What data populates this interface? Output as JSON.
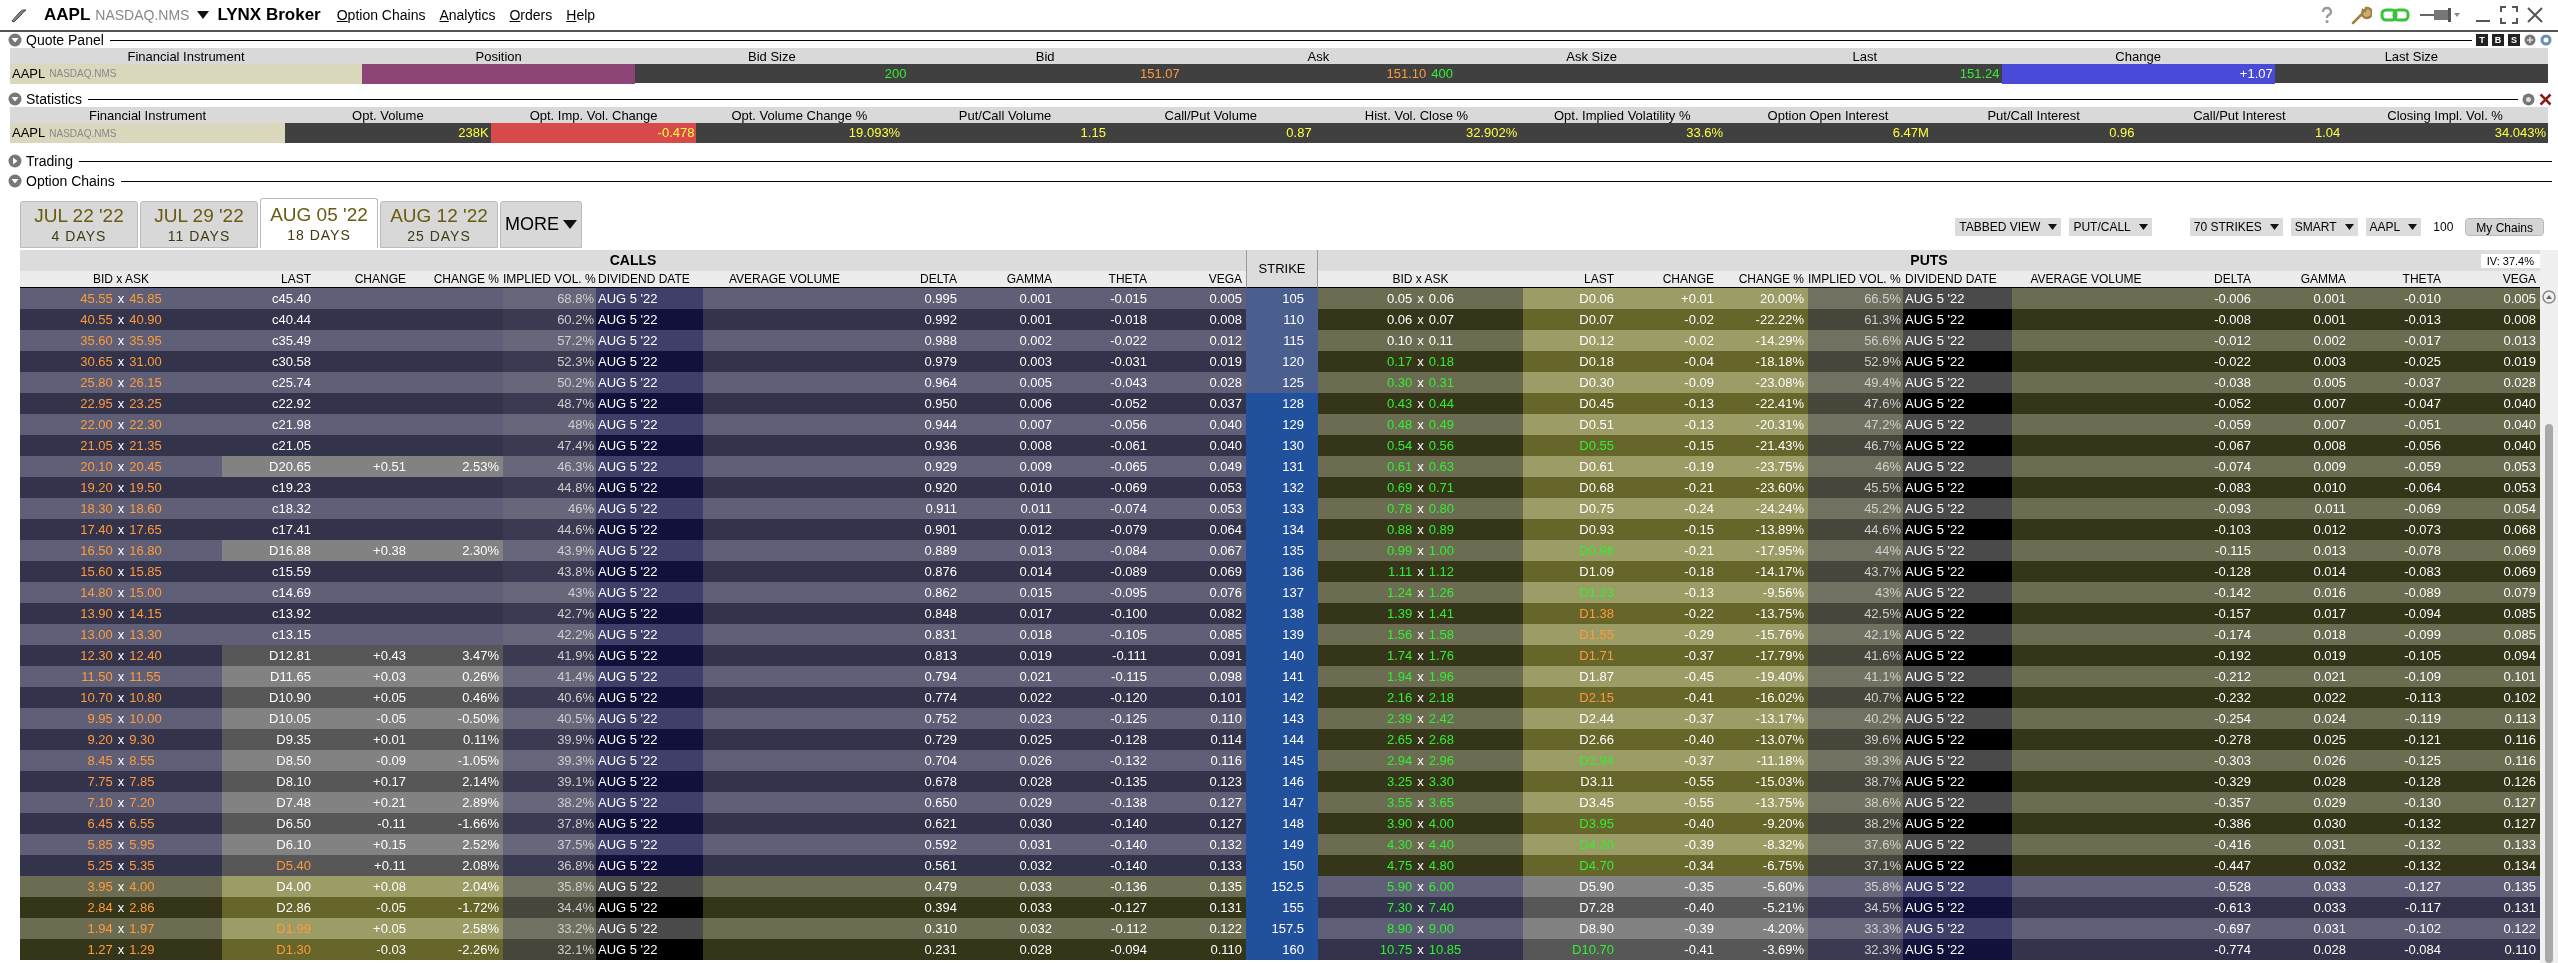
{
  "window": {
    "symbol": "AAPL",
    "exchange": "NASDAQ.NMS",
    "broker": "LYNX Broker"
  },
  "menu": [
    "Option Chains",
    "Analytics",
    "Orders",
    "Help"
  ],
  "quote_panel": {
    "title": "Quote Panel",
    "expanded": true,
    "panel_buttons": [
      "T",
      "B",
      "S"
    ],
    "header_instrument": "Financial Instrument",
    "instrument": {
      "symbol": "AAPL",
      "exchange": "NASDAQ.NMS"
    },
    "cells": [
      {
        "label": "Position",
        "color": "#8b4577"
      },
      {
        "label": "Bid Size",
        "values": [
          {
            "text": "200",
            "up": true,
            "down": false
          }
        ]
      },
      {
        "label": "Bid",
        "values": [
          {
            "text": "151.07",
            "up": false,
            "down": true
          }
        ]
      },
      {
        "label": "Ask",
        "values": [
          {
            "text": "151.10",
            "up": false,
            "down": true
          },
          {
            "text": "400",
            "up": true,
            "down": false
          }
        ]
      },
      {
        "label": "Ask Size"
      },
      {
        "label": "Last",
        "values": [
          {
            "text": "151.24",
            "up": true,
            "down": false
          }
        ]
      },
      {
        "label": "Change",
        "color": "#4a4ad8",
        "values": [
          {
            "text": "+1.07",
            "up": false,
            "down": false
          }
        ]
      },
      {
        "label": "Last Size"
      }
    ]
  },
  "statistics": {
    "title": "Statistics",
    "expanded": true,
    "header_instrument": "Financial Instrument",
    "instrument": {
      "symbol": "AAPL",
      "exchange": "NASDAQ.NMS"
    },
    "cells": [
      {
        "label": "Opt. Volume",
        "value": "238K"
      },
      {
        "label": "Opt. Imp. Vol. Change",
        "value": "-0.478",
        "color": "#d84a4a"
      },
      {
        "label": "Opt. Volume Change %",
        "value": "19.093%"
      },
      {
        "label": "Put/Call Volume",
        "value": "1.15"
      },
      {
        "label": "Call/Put Volume",
        "value": "0.87"
      },
      {
        "label": "Hist. Vol. Close %",
        "value": "32.902%"
      },
      {
        "label": "Opt. Implied Volatility %",
        "value": "33.6%"
      },
      {
        "label": "Option Open Interest",
        "value": "6.47M"
      },
      {
        "label": "Put/Call Interest",
        "value": "0.96"
      },
      {
        "label": "Call/Put Interest",
        "value": "1.04"
      },
      {
        "label": "Closing Impl. Vol. %",
        "value": "34.043%"
      }
    ]
  },
  "trading": {
    "title": "Trading",
    "expanded": false
  },
  "option_chains": {
    "title": "Option Chains",
    "expanded": true,
    "expiries": [
      {
        "date": "JUL 22 '22",
        "days": "4 DAYS",
        "selected": false
      },
      {
        "date": "JUL 29 '22",
        "days": "11 DAYS",
        "selected": false
      },
      {
        "date": "AUG 05 '22",
        "days": "18 DAYS",
        "selected": true
      },
      {
        "date": "AUG 12 '22",
        "days": "25 DAYS",
        "selected": false
      }
    ],
    "more": "MORE",
    "controls": [
      {
        "label": "TABBED VIEW",
        "kind": "dropdown"
      },
      {
        "label": "PUT/CALL",
        "kind": "dropdown"
      },
      {
        "label": "70 STRIKES",
        "kind": "dropdown"
      },
      {
        "label": "SMART",
        "kind": "dropdown"
      },
      {
        "label": "AAPL",
        "kind": "dropdown"
      },
      {
        "label": "100",
        "kind": "text"
      },
      {
        "label": "My Chains",
        "kind": "button"
      }
    ],
    "iv": "IV: 37.4%",
    "calls_title": "CALLS",
    "puts_title": "PUTS",
    "strike_header": "STRIKE",
    "calls_columns": [
      "BID x ASK",
      "LAST",
      "CHANGE",
      "CHANGE %",
      "IMPLIED VOL. %",
      "DIVIDEND DATE",
      "AVERAGE VOLUME",
      "DELTA",
      "GAMMA",
      "THETA",
      "VEGA"
    ],
    "puts_columns": [
      "BID x ASK",
      "LAST",
      "CHANGE",
      "CHANGE %",
      "IMPLIED VOL. %",
      "DIVIDEND DATE",
      "AVERAGE VOLUME",
      "DELTA",
      "GAMMA",
      "THETA",
      "VEGA"
    ],
    "rows": [
      {
        "strike": "105",
        "call": {
          "itm": true,
          "bid_ask": {
            "text": "45.55 x 45.85",
            "up": false,
            "down": true
          },
          "last": {
            "text": "c45.40",
            "up": false,
            "down": false
          },
          "iv": "68.8%",
          "dividend_date": "AUG 5 '22",
          "delta": "0.995",
          "gamma": "0.001",
          "theta": "-0.015",
          "vega": "0.005"
        },
        "put": {
          "itm": false,
          "bid_ask": {
            "text": "0.05 x 0.06",
            "up": false,
            "down": false
          },
          "last": {
            "text": "D0.06",
            "up": false,
            "down": false
          },
          "change": "+0.01",
          "change_pct": "20.00%",
          "iv": "66.5%",
          "dividend_date": "AUG 5 '22",
          "delta": "-0.006",
          "gamma": "0.001",
          "theta": "-0.010",
          "vega": "0.005"
        }
      },
      {
        "strike": "110",
        "call": {
          "itm": true,
          "bid_ask": {
            "text": "40.55 x 40.90",
            "up": false,
            "down": true
          },
          "last": {
            "text": "c40.44",
            "up": false,
            "down": false
          },
          "iv": "60.2%",
          "dividend_date": "AUG 5 '22",
          "delta": "0.992",
          "gamma": "0.001",
          "theta": "-0.018",
          "vega": "0.008"
        },
        "put": {
          "itm": false,
          "bid_ask": {
            "text": "0.06 x 0.07",
            "up": false,
            "down": false
          },
          "last": {
            "text": "D0.07",
            "up": false,
            "down": false
          },
          "change": "-0.02",
          "change_pct": "-22.22%",
          "iv": "61.3%",
          "dividend_date": "AUG 5 '22",
          "delta": "-0.008",
          "gamma": "0.001",
          "theta": "-0.013",
          "vega": "0.008"
        }
      },
      {
        "strike": "115",
        "call": {
          "itm": true,
          "bid_ask": {
            "text": "35.60 x 35.95",
            "up": false,
            "down": true
          },
          "last": {
            "text": "c35.49",
            "up": false,
            "down": false
          },
          "iv": "57.2%",
          "dividend_date": "AUG 5 '22",
          "delta": "0.988",
          "gamma": "0.002",
          "theta": "-0.022",
          "vega": "0.012"
        },
        "put": {
          "itm": false,
          "bid_ask": {
            "text": "0.10 x 0.11",
            "up": false,
            "down": false
          },
          "last": {
            "text": "D0.12",
            "up": false,
            "down": false
          },
          "change": "-0.02",
          "change_pct": "-14.29%",
          "iv": "56.6%",
          "dividend_date": "AUG 5 '22",
          "delta": "-0.012",
          "gamma": "0.002",
          "theta": "-0.017",
          "vega": "0.013"
        }
      },
      {
        "strike": "120",
        "call": {
          "itm": true,
          "bid_ask": {
            "text": "30.65 x 31.00",
            "up": false,
            "down": true
          },
          "last": {
            "text": "c30.58",
            "up": false,
            "down": false
          },
          "iv": "52.3%",
          "dividend_date": "AUG 5 '22",
          "delta": "0.979",
          "gamma": "0.003",
          "theta": "-0.031",
          "vega": "0.019"
        },
        "put": {
          "itm": false,
          "bid_ask": {
            "text": "0.17 x 0.18",
            "up": true,
            "down": false
          },
          "last": {
            "text": "D0.18",
            "up": false,
            "down": false
          },
          "change": "-0.04",
          "change_pct": "-18.18%",
          "iv": "52.9%",
          "dividend_date": "AUG 5 '22",
          "delta": "-0.022",
          "gamma": "0.003",
          "theta": "-0.025",
          "vega": "0.019"
        }
      },
      {
        "strike": "125",
        "call": {
          "itm": true,
          "bid_ask": {
            "text": "25.80 x 26.15",
            "up": false,
            "down": true
          },
          "last": {
            "text": "c25.74",
            "up": false,
            "down": false
          },
          "iv": "50.2%",
          "dividend_date": "AUG 5 '22",
          "delta": "0.964",
          "gamma": "0.005",
          "theta": "-0.043",
          "vega": "0.028"
        },
        "put": {
          "itm": false,
          "bid_ask": {
            "text": "0.30 x 0.31",
            "up": true,
            "down": false
          },
          "last": {
            "text": "D0.30",
            "up": false,
            "down": false
          },
          "change": "-0.09",
          "change_pct": "-23.08%",
          "iv": "49.4%",
          "dividend_date": "AUG 5 '22",
          "delta": "-0.038",
          "gamma": "0.005",
          "theta": "-0.037",
          "vega": "0.028"
        }
      },
      {
        "strike": "128",
        "call": {
          "itm": true,
          "bid_ask": {
            "text": "22.95 x 23.25",
            "up": false,
            "down": true
          },
          "last": {
            "text": "c22.92",
            "up": false,
            "down": false
          },
          "iv": "48.7%",
          "dividend_date": "AUG 5 '22",
          "delta": "0.950",
          "gamma": "0.006",
          "theta": "-0.052",
          "vega": "0.037"
        },
        "put": {
          "itm": false,
          "bid_ask": {
            "text": "0.43 x 0.44",
            "up": true,
            "down": false
          },
          "last": {
            "text": "D0.45",
            "up": false,
            "down": false
          },
          "change": "-0.13",
          "change_pct": "-22.41%",
          "iv": "47.6%",
          "dividend_date": "AUG 5 '22",
          "delta": "-0.052",
          "gamma": "0.007",
          "theta": "-0.047",
          "vega": "0.040"
        }
      },
      {
        "strike": "129",
        "call": {
          "itm": true,
          "bid_ask": {
            "text": "22.00 x 22.30",
            "up": false,
            "down": true
          },
          "last": {
            "text": "c21.98",
            "up": false,
            "down": false
          },
          "iv": "48%",
          "dividend_date": "AUG 5 '22",
          "delta": "0.944",
          "gamma": "0.007",
          "theta": "-0.056",
          "vega": "0.040"
        },
        "put": {
          "itm": false,
          "bid_ask": {
            "text": "0.48 x 0.49",
            "up": true,
            "down": false
          },
          "last": {
            "text": "D0.51",
            "up": false,
            "down": false
          },
          "change": "-0.13",
          "change_pct": "-20.31%",
          "iv": "47.2%",
          "dividend_date": "AUG 5 '22",
          "delta": "-0.059",
          "gamma": "0.007",
          "theta": "-0.051",
          "vega": "0.040"
        }
      },
      {
        "strike": "130",
        "call": {
          "itm": true,
          "bid_ask": {
            "text": "21.05 x 21.35",
            "up": false,
            "down": true
          },
          "last": {
            "text": "c21.05",
            "up": false,
            "down": false
          },
          "iv": "47.4%",
          "dividend_date": "AUG 5 '22",
          "delta": "0.936",
          "gamma": "0.008",
          "theta": "-0.061",
          "vega": "0.040"
        },
        "put": {
          "itm": false,
          "bid_ask": {
            "text": "0.54 x 0.56",
            "up": true,
            "down": false
          },
          "last": {
            "text": "D0.55",
            "up": true,
            "down": false
          },
          "change": "-0.15",
          "change_pct": "-21.43%",
          "iv": "46.7%",
          "dividend_date": "AUG 5 '22",
          "delta": "-0.067",
          "gamma": "0.008",
          "theta": "-0.056",
          "vega": "0.040"
        }
      },
      {
        "strike": "131",
        "call": {
          "itm": true,
          "bid_ask": {
            "text": "20.10 x 20.45",
            "up": false,
            "down": true
          },
          "last": {
            "text": "D20.65",
            "up": false,
            "down": false
          },
          "change": "+0.51",
          "change_pct": "2.53%",
          "iv": "46.3%",
          "dividend_date": "AUG 5 '22",
          "delta": "0.929",
          "gamma": "0.009",
          "theta": "-0.065",
          "vega": "0.049"
        },
        "put": {
          "itm": false,
          "bid_ask": {
            "text": "0.61 x 0.63",
            "up": true,
            "down": false
          },
          "last": {
            "text": "D0.61",
            "up": false,
            "down": false
          },
          "change": "-0.19",
          "change_pct": "-23.75%",
          "iv": "46%",
          "dividend_date": "AUG 5 '22",
          "delta": "-0.074",
          "gamma": "0.009",
          "theta": "-0.059",
          "vega": "0.053"
        }
      },
      {
        "strike": "132",
        "call": {
          "itm": true,
          "bid_ask": {
            "text": "19.20 x 19.50",
            "up": false,
            "down": true
          },
          "last": {
            "text": "c19.23",
            "up": false,
            "down": false
          },
          "iv": "44.8%",
          "dividend_date": "AUG 5 '22",
          "delta": "0.920",
          "gamma": "0.010",
          "theta": "-0.069",
          "vega": "0.053"
        },
        "put": {
          "itm": false,
          "bid_ask": {
            "text": "0.69 x 0.71",
            "up": true,
            "down": false
          },
          "last": {
            "text": "D0.68",
            "up": false,
            "down": false
          },
          "change": "-0.21",
          "change_pct": "-23.60%",
          "iv": "45.5%",
          "dividend_date": "AUG 5 '22",
          "delta": "-0.083",
          "gamma": "0.010",
          "theta": "-0.064",
          "vega": "0.053"
        }
      },
      {
        "strike": "133",
        "call": {
          "itm": true,
          "bid_ask": {
            "text": "18.30 x 18.60",
            "up": false,
            "down": true
          },
          "last": {
            "text": "c18.32",
            "up": false,
            "down": false
          },
          "iv": "46%",
          "dividend_date": "AUG 5 '22",
          "delta": "0.911",
          "gamma": "0.011",
          "theta": "-0.074",
          "vega": "0.053"
        },
        "put": {
          "itm": false,
          "bid_ask": {
            "text": "0.78 x 0.80",
            "up": true,
            "down": false
          },
          "last": {
            "text": "D0.75",
            "up": false,
            "down": false
          },
          "change": "-0.24",
          "change_pct": "-24.24%",
          "iv": "45.2%",
          "dividend_date": "AUG 5 '22",
          "delta": "-0.093",
          "gamma": "0.011",
          "theta": "-0.069",
          "vega": "0.054"
        }
      },
      {
        "strike": "134",
        "call": {
          "itm": true,
          "bid_ask": {
            "text": "17.40 x 17.65",
            "up": false,
            "down": true
          },
          "last": {
            "text": "c17.41",
            "up": false,
            "down": false
          },
          "iv": "44.6%",
          "dividend_date": "AUG 5 '22",
          "delta": "0.901",
          "gamma": "0.012",
          "theta": "-0.079",
          "vega": "0.064"
        },
        "put": {
          "itm": false,
          "bid_ask": {
            "text": "0.88 x 0.89",
            "up": true,
            "down": false
          },
          "last": {
            "text": "D0.93",
            "up": false,
            "down": false
          },
          "change": "-0.15",
          "change_pct": "-13.89%",
          "iv": "44.6%",
          "dividend_date": "AUG 5 '22",
          "delta": "-0.103",
          "gamma": "0.012",
          "theta": "-0.073",
          "vega": "0.068"
        }
      },
      {
        "strike": "135",
        "call": {
          "itm": true,
          "bid_ask": {
            "text": "16.50 x 16.80",
            "up": false,
            "down": true
          },
          "last": {
            "text": "D16.88",
            "up": false,
            "down": false
          },
          "change": "+0.38",
          "change_pct": "2.30%",
          "iv": "43.9%",
          "dividend_date": "AUG 5 '22",
          "delta": "0.889",
          "gamma": "0.013",
          "theta": "-0.084",
          "vega": "0.067"
        },
        "put": {
          "itm": false,
          "bid_ask": {
            "text": "0.99 x 1.00",
            "up": true,
            "down": false
          },
          "last": {
            "text": "D0.96",
            "up": true,
            "down": false
          },
          "change": "-0.21",
          "change_pct": "-17.95%",
          "iv": "44%",
          "dividend_date": "AUG 5 '22",
          "delta": "-0.115",
          "gamma": "0.013",
          "theta": "-0.078",
          "vega": "0.069"
        }
      },
      {
        "strike": "136",
        "call": {
          "itm": true,
          "bid_ask": {
            "text": "15.60 x 15.85",
            "up": false,
            "down": true
          },
          "last": {
            "text": "c15.59",
            "up": false,
            "down": false
          },
          "iv": "43.8%",
          "dividend_date": "AUG 5 '22",
          "delta": "0.876",
          "gamma": "0.014",
          "theta": "-0.089",
          "vega": "0.069"
        },
        "put": {
          "itm": false,
          "bid_ask": {
            "text": "1.11 x 1.12",
            "up": true,
            "down": false
          },
          "last": {
            "text": "D1.09",
            "up": false,
            "down": false
          },
          "change": "-0.18",
          "change_pct": "-14.17%",
          "iv": "43.7%",
          "dividend_date": "AUG 5 '22",
          "delta": "-0.128",
          "gamma": "0.014",
          "theta": "-0.083",
          "vega": "0.069"
        }
      },
      {
        "strike": "137",
        "call": {
          "itm": true,
          "bid_ask": {
            "text": "14.80 x 15.00",
            "up": false,
            "down": true
          },
          "last": {
            "text": "c14.69",
            "up": false,
            "down": false
          },
          "iv": "43%",
          "dividend_date": "AUG 5 '22",
          "delta": "0.862",
          "gamma": "0.015",
          "theta": "-0.095",
          "vega": "0.076"
        },
        "put": {
          "itm": false,
          "bid_ask": {
            "text": "1.24 x 1.26",
            "up": true,
            "down": false
          },
          "last": {
            "text": "D1.23",
            "up": true,
            "down": false
          },
          "change": "-0.13",
          "change_pct": "-9.56%",
          "iv": "43%",
          "dividend_date": "AUG 5 '22",
          "delta": "-0.142",
          "gamma": "0.016",
          "theta": "-0.089",
          "vega": "0.079"
        }
      },
      {
        "strike": "138",
        "call": {
          "itm": true,
          "bid_ask": {
            "text": "13.90 x 14.15",
            "up": false,
            "down": true
          },
          "last": {
            "text": "c13.92",
            "up": false,
            "down": false
          },
          "iv": "42.7%",
          "dividend_date": "AUG 5 '22",
          "delta": "0.848",
          "gamma": "0.017",
          "theta": "-0.100",
          "vega": "0.082"
        },
        "put": {
          "itm": false,
          "bid_ask": {
            "text": "1.39 x 1.41",
            "up": true,
            "down": false
          },
          "last": {
            "text": "D1.38",
            "up": false,
            "down": true
          },
          "change": "-0.22",
          "change_pct": "-13.75%",
          "iv": "42.5%",
          "dividend_date": "AUG 5 '22",
          "delta": "-0.157",
          "gamma": "0.017",
          "theta": "-0.094",
          "vega": "0.085"
        }
      },
      {
        "strike": "139",
        "call": {
          "itm": true,
          "bid_ask": {
            "text": "13.00 x 13.30",
            "up": false,
            "down": true
          },
          "last": {
            "text": "c13.15",
            "up": false,
            "down": false
          },
          "iv": "42.2%",
          "dividend_date": "AUG 5 '22",
          "delta": "0.831",
          "gamma": "0.018",
          "theta": "-0.105",
          "vega": "0.085"
        },
        "put": {
          "itm": false,
          "bid_ask": {
            "text": "1.56 x 1.58",
            "up": true,
            "down": false
          },
          "last": {
            "text": "D1.55",
            "up": false,
            "down": true
          },
          "change": "-0.29",
          "change_pct": "-15.76%",
          "iv": "42.1%",
          "dividend_date": "AUG 5 '22",
          "delta": "-0.174",
          "gamma": "0.018",
          "theta": "-0.099",
          "vega": "0.085"
        }
      },
      {
        "strike": "140",
        "call": {
          "itm": true,
          "bid_ask": {
            "text": "12.30 x 12.40",
            "up": false,
            "down": true
          },
          "last": {
            "text": "D12.81",
            "up": false,
            "down": false
          },
          "change": "+0.43",
          "change_pct": "3.47%",
          "iv": "41.9%",
          "dividend_date": "AUG 5 '22",
          "delta": "0.813",
          "gamma": "0.019",
          "theta": "-0.111",
          "vega": "0.091"
        },
        "put": {
          "itm": false,
          "bid_ask": {
            "text": "1.74 x 1.76",
            "up": true,
            "down": false
          },
          "last": {
            "text": "D1.71",
            "up": false,
            "down": true
          },
          "change": "-0.37",
          "change_pct": "-17.79%",
          "iv": "41.6%",
          "dividend_date": "AUG 5 '22",
          "delta": "-0.192",
          "gamma": "0.019",
          "theta": "-0.105",
          "vega": "0.094"
        }
      },
      {
        "strike": "141",
        "call": {
          "itm": true,
          "bid_ask": {
            "text": "11.50 x 11.55",
            "up": false,
            "down": true
          },
          "last": {
            "text": "D11.65",
            "up": false,
            "down": false
          },
          "change": "+0.03",
          "change_pct": "0.26%",
          "iv": "41.4%",
          "dividend_date": "AUG 5 '22",
          "delta": "0.794",
          "gamma": "0.021",
          "theta": "-0.115",
          "vega": "0.098"
        },
        "put": {
          "itm": false,
          "bid_ask": {
            "text": "1.94 x 1.96",
            "up": true,
            "down": false
          },
          "last": {
            "text": "D1.87",
            "up": false,
            "down": false
          },
          "change": "-0.45",
          "change_pct": "-19.40%",
          "iv": "41.1%",
          "dividend_date": "AUG 5 '22",
          "delta": "-0.212",
          "gamma": "0.021",
          "theta": "-0.109",
          "vega": "0.101"
        }
      },
      {
        "strike": "142",
        "call": {
          "itm": true,
          "bid_ask": {
            "text": "10.70 x 10.80",
            "up": false,
            "down": true
          },
          "last": {
            "text": "D10.90",
            "up": false,
            "down": false
          },
          "change": "+0.05",
          "change_pct": "0.46%",
          "iv": "40.6%",
          "dividend_date": "AUG 5 '22",
          "delta": "0.774",
          "gamma": "0.022",
          "theta": "-0.120",
          "vega": "0.101"
        },
        "put": {
          "itm": false,
          "bid_ask": {
            "text": "2.16 x 2.18",
            "up": true,
            "down": false
          },
          "last": {
            "text": "D2.15",
            "up": false,
            "down": true
          },
          "change": "-0.41",
          "change_pct": "-16.02%",
          "iv": "40.7%",
          "dividend_date": "AUG 5 '22",
          "delta": "-0.232",
          "gamma": "0.022",
          "theta": "-0.113",
          "vega": "0.102"
        }
      },
      {
        "strike": "143",
        "call": {
          "itm": true,
          "bid_ask": {
            "text": "9.95 x 10.00",
            "up": false,
            "down": true
          },
          "last": {
            "text": "D10.05",
            "up": false,
            "down": false
          },
          "change": "-0.05",
          "change_pct": "-0.50%",
          "iv": "40.5%",
          "dividend_date": "AUG 5 '22",
          "delta": "0.752",
          "gamma": "0.023",
          "theta": "-0.125",
          "vega": "0.110"
        },
        "put": {
          "itm": false,
          "bid_ask": {
            "text": "2.39 x 2.42",
            "up": true,
            "down": false
          },
          "last": {
            "text": "D2.44",
            "up": false,
            "down": false
          },
          "change": "-0.37",
          "change_pct": "-13.17%",
          "iv": "40.2%",
          "dividend_date": "AUG 5 '22",
          "delta": "-0.254",
          "gamma": "0.024",
          "theta": "-0.119",
          "vega": "0.113"
        }
      },
      {
        "strike": "144",
        "call": {
          "itm": true,
          "bid_ask": {
            "text": "9.20 x 9.30",
            "up": false,
            "down": true
          },
          "last": {
            "text": "D9.35",
            "up": false,
            "down": false
          },
          "change": "+0.01",
          "change_pct": "0.11%",
          "iv": "39.9%",
          "dividend_date": "AUG 5 '22",
          "delta": "0.729",
          "gamma": "0.025",
          "theta": "-0.128",
          "vega": "0.114"
        },
        "put": {
          "itm": false,
          "bid_ask": {
            "text": "2.65 x 2.68",
            "up": true,
            "down": false
          },
          "last": {
            "text": "D2.66",
            "up": false,
            "down": false
          },
          "change": "-0.40",
          "change_pct": "-13.07%",
          "iv": "39.6%",
          "dividend_date": "AUG 5 '22",
          "delta": "-0.278",
          "gamma": "0.025",
          "theta": "-0.121",
          "vega": "0.116"
        }
      },
      {
        "strike": "145",
        "call": {
          "itm": true,
          "bid_ask": {
            "text": "8.45 x 8.55",
            "up": false,
            "down": true
          },
          "last": {
            "text": "D8.50",
            "up": false,
            "down": false
          },
          "change": "-0.09",
          "change_pct": "-1.05%",
          "iv": "39.3%",
          "dividend_date": "AUG 5 '22",
          "delta": "0.704",
          "gamma": "0.026",
          "theta": "-0.132",
          "vega": "0.116"
        },
        "put": {
          "itm": false,
          "bid_ask": {
            "text": "2.94 x 2.96",
            "up": true,
            "down": false
          },
          "last": {
            "text": "D2.94",
            "up": true,
            "down": false
          },
          "change": "-0.37",
          "change_pct": "-11.18%",
          "iv": "39.3%",
          "dividend_date": "AUG 5 '22",
          "delta": "-0.303",
          "gamma": "0.026",
          "theta": "-0.125",
          "vega": "0.116"
        }
      },
      {
        "strike": "146",
        "call": {
          "itm": true,
          "bid_ask": {
            "text": "7.75 x 7.85",
            "up": false,
            "down": true
          },
          "last": {
            "text": "D8.10",
            "up": false,
            "down": false
          },
          "change": "+0.17",
          "change_pct": "2.14%",
          "iv": "39.1%",
          "dividend_date": "AUG 5 '22",
          "delta": "0.678",
          "gamma": "0.028",
          "theta": "-0.135",
          "vega": "0.123"
        },
        "put": {
          "itm": false,
          "bid_ask": {
            "text": "3.25 x 3.30",
            "up": true,
            "down": false
          },
          "last": {
            "text": "D3.11",
            "up": false,
            "down": false
          },
          "change": "-0.55",
          "change_pct": "-15.03%",
          "iv": "38.7%",
          "dividend_date": "AUG 5 '22",
          "delta": "-0.329",
          "gamma": "0.028",
          "theta": "-0.128",
          "vega": "0.126"
        }
      },
      {
        "strike": "147",
        "call": {
          "itm": true,
          "bid_ask": {
            "text": "7.10 x 7.20",
            "up": false,
            "down": true
          },
          "last": {
            "text": "D7.48",
            "up": false,
            "down": false
          },
          "change": "+0.21",
          "change_pct": "2.89%",
          "iv": "38.2%",
          "dividend_date": "AUG 5 '22",
          "delta": "0.650",
          "gamma": "0.029",
          "theta": "-0.138",
          "vega": "0.127"
        },
        "put": {
          "itm": false,
          "bid_ask": {
            "text": "3.55 x 3.65",
            "up": true,
            "down": false
          },
          "last": {
            "text": "D3.45",
            "up": false,
            "down": false
          },
          "change": "-0.55",
          "change_pct": "-13.75%",
          "iv": "38.6%",
          "dividend_date": "AUG 5 '22",
          "delta": "-0.357",
          "gamma": "0.029",
          "theta": "-0.130",
          "vega": "0.127"
        }
      },
      {
        "strike": "148",
        "call": {
          "itm": true,
          "bid_ask": {
            "text": "6.45 x 6.55",
            "up": false,
            "down": true
          },
          "last": {
            "text": "D6.50",
            "up": false,
            "down": false
          },
          "change": "-0.11",
          "change_pct": "-1.66%",
          "iv": "37.8%",
          "dividend_date": "AUG 5 '22",
          "delta": "0.621",
          "gamma": "0.030",
          "theta": "-0.140",
          "vega": "0.127"
        },
        "put": {
          "itm": false,
          "bid_ask": {
            "text": "3.90 x 4.00",
            "up": true,
            "down": false
          },
          "last": {
            "text": "D3.95",
            "up": true,
            "down": false
          },
          "change": "-0.40",
          "change_pct": "-9.20%",
          "iv": "38.2%",
          "dividend_date": "AUG 5 '22",
          "delta": "-0.386",
          "gamma": "0.030",
          "theta": "-0.132",
          "vega": "0.127"
        }
      },
      {
        "strike": "149",
        "call": {
          "itm": true,
          "bid_ask": {
            "text": "5.85 x 5.95",
            "up": false,
            "down": true
          },
          "last": {
            "text": "D6.10",
            "up": false,
            "down": false
          },
          "change": "+0.15",
          "change_pct": "2.52%",
          "iv": "37.5%",
          "dividend_date": "AUG 5 '22",
          "delta": "0.592",
          "gamma": "0.031",
          "theta": "-0.140",
          "vega": "0.132"
        },
        "put": {
          "itm": false,
          "bid_ask": {
            "text": "4.30 x 4.40",
            "up": true,
            "down": false
          },
          "last": {
            "text": "D4.30",
            "up": true,
            "down": false
          },
          "change": "-0.39",
          "change_pct": "-8.32%",
          "iv": "37.6%",
          "dividend_date": "AUG 5 '22",
          "delta": "-0.416",
          "gamma": "0.031",
          "theta": "-0.132",
          "vega": "0.133"
        }
      },
      {
        "strike": "150",
        "call": {
          "itm": true,
          "bid_ask": {
            "text": "5.25 x 5.35",
            "up": false,
            "down": true
          },
          "last": {
            "text": "D5.40",
            "up": false,
            "down": true
          },
          "change": "+0.11",
          "change_pct": "2.08%",
          "iv": "36.8%",
          "dividend_date": "AUG 5 '22",
          "delta": "0.561",
          "gamma": "0.032",
          "theta": "-0.140",
          "vega": "0.133"
        },
        "put": {
          "itm": false,
          "bid_ask": {
            "text": "4.75 x 4.80",
            "up": true,
            "down": false
          },
          "last": {
            "text": "D4.70",
            "up": true,
            "down": false
          },
          "change": "-0.34",
          "change_pct": "-6.75%",
          "iv": "37.1%",
          "dividend_date": "AUG 5 '22",
          "delta": "-0.447",
          "gamma": "0.032",
          "theta": "-0.132",
          "vega": "0.134"
        }
      },
      {
        "strike": "152.5",
        "call": {
          "itm": false,
          "bid_ask": {
            "text": "3.95 x 4.00",
            "up": false,
            "down": true
          },
          "last": {
            "text": "D4.00",
            "up": false,
            "down": false
          },
          "change": "+0.08",
          "change_pct": "2.04%",
          "iv": "35.8%",
          "dividend_date": "AUG 5 '22",
          "delta": "0.479",
          "gamma": "0.033",
          "theta": "-0.136",
          "vega": "0.135"
        },
        "put": {
          "itm": true,
          "bid_ask": {
            "text": "5.90 x 6.00",
            "up": true,
            "down": false
          },
          "last": {
            "text": "D5.90",
            "up": false,
            "down": false
          },
          "change": "-0.35",
          "change_pct": "-5.60%",
          "iv": "35.8%",
          "dividend_date": "AUG 5 '22",
          "delta": "-0.528",
          "gamma": "0.033",
          "theta": "-0.127",
          "vega": "0.135"
        }
      },
      {
        "strike": "155",
        "call": {
          "itm": false,
          "bid_ask": {
            "text": "2.84 x 2.86",
            "up": false,
            "down": true
          },
          "last": {
            "text": "D2.86",
            "up": false,
            "down": false
          },
          "change": "-0.05",
          "change_pct": "-1.72%",
          "iv": "34.4%",
          "dividend_date": "AUG 5 '22",
          "delta": "0.394",
          "gamma": "0.033",
          "theta": "-0.127",
          "vega": "0.131"
        },
        "put": {
          "itm": true,
          "bid_ask": {
            "text": "7.30 x 7.40",
            "up": true,
            "down": false
          },
          "last": {
            "text": "D7.28",
            "up": false,
            "down": false
          },
          "change": "-0.40",
          "change_pct": "-5.21%",
          "iv": "34.5%",
          "dividend_date": "AUG 5 '22",
          "delta": "-0.613",
          "gamma": "0.033",
          "theta": "-0.117",
          "vega": "0.131"
        }
      },
      {
        "strike": "157.5",
        "call": {
          "itm": false,
          "bid_ask": {
            "text": "1.94 x 1.97",
            "up": false,
            "down": true
          },
          "last": {
            "text": "D1.99",
            "up": false,
            "down": true
          },
          "change": "+0.05",
          "change_pct": "2.58%",
          "iv": "33.2%",
          "dividend_date": "AUG 5 '22",
          "delta": "0.310",
          "gamma": "0.032",
          "theta": "-0.112",
          "vega": "0.122"
        },
        "put": {
          "itm": true,
          "bid_ask": {
            "text": "8.90 x 9.00",
            "up": true,
            "down": false
          },
          "last": {
            "text": "D8.90",
            "up": false,
            "down": false
          },
          "change": "-0.39",
          "change_pct": "-4.20%",
          "iv": "33.3%",
          "dividend_date": "AUG 5 '22",
          "delta": "-0.697",
          "gamma": "0.031",
          "theta": "-0.102",
          "vega": "0.122"
        }
      },
      {
        "strike": "160",
        "call": {
          "itm": false,
          "bid_ask": {
            "text": "1.27 x 1.29",
            "up": false,
            "down": true
          },
          "last": {
            "text": "D1.30",
            "up": false,
            "down": true
          },
          "change": "-0.03",
          "change_pct": "-2.26%",
          "iv": "32.1%",
          "dividend_date": "AUG 5 '22",
          "delta": "0.231",
          "gamma": "0.028",
          "theta": "-0.094",
          "vega": "0.110"
        },
        "put": {
          "itm": true,
          "bid_ask": {
            "text": "10.75 x 10.85",
            "up": true,
            "down": false
          },
          "last": {
            "text": "D10.70",
            "up": true,
            "down": false
          },
          "change": "-0.41",
          "change_pct": "-3.69%",
          "iv": "32.3%",
          "dividend_date": "AUG 5 '22",
          "delta": "-0.774",
          "gamma": "0.028",
          "theta": "-0.084",
          "vega": "0.110"
        }
      }
    ]
  }
}
